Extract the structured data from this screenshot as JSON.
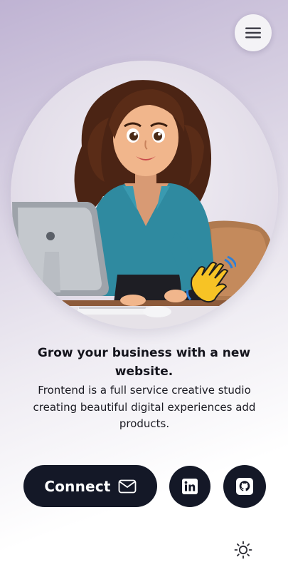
{
  "header": {
    "menu_icon": "hamburger-menu-icon"
  },
  "hero": {
    "illustration": "woman-at-computer-illustration",
    "emoji_icon": "waving-hand-icon"
  },
  "intro": {
    "headline": "Grow your business with a new website.",
    "description": "Frontend is a full service creative studio creating beautiful digital experiences add products."
  },
  "actions": {
    "connect_label": "Connect",
    "connect_icon": "mail-icon",
    "linkedin_icon": "linkedin-icon",
    "github_icon": "github-icon"
  },
  "footer": {
    "theme_icon": "sun-icon"
  },
  "colors": {
    "button_bg": "#141827",
    "button_fg": "#ffffff",
    "text": "#14141c",
    "bg_top": "#bfb3d3",
    "bg_bottom": "#ffffff"
  }
}
